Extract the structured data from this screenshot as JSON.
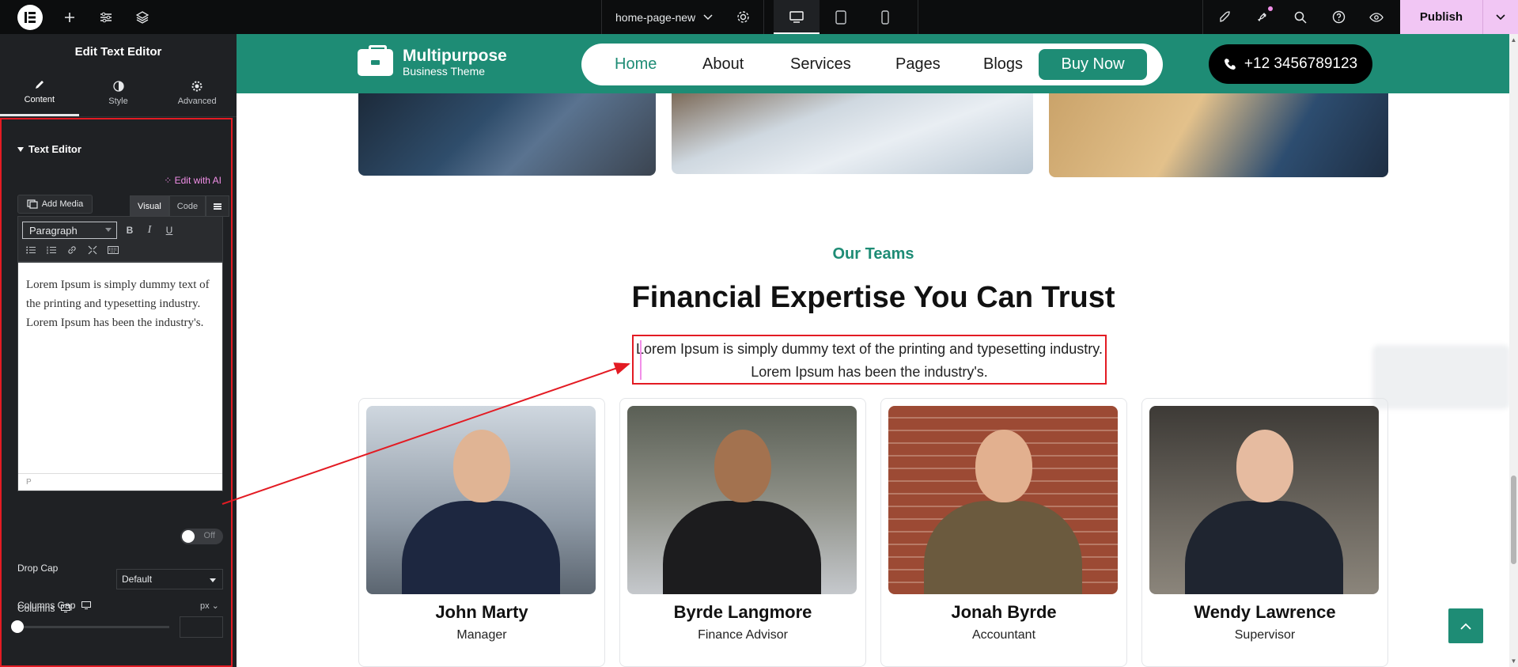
{
  "topbar": {
    "document_name": "home-page-new",
    "publish_label": "Publish"
  },
  "panel": {
    "title": "Edit Text Editor",
    "tabs": [
      {
        "label": "Content",
        "icon": "pencil-icon"
      },
      {
        "label": "Style",
        "icon": "half-circle-icon"
      },
      {
        "label": "Advanced",
        "icon": "gear-icon"
      }
    ],
    "section_title": "Text Editor",
    "edit_with_ai": "Edit with AI",
    "add_media": "Add Media",
    "mode_visual": "Visual",
    "mode_code": "Code",
    "format_select": "Paragraph",
    "editor_text": "Lorem Ipsum is simply dummy text of the printing and typesetting industry. Lorem Ipsum has been the industry's.",
    "editor_status": "P",
    "drop_cap_label": "Drop Cap",
    "drop_cap_state": "Off",
    "columns_label": "Columns",
    "columns_value": "Default",
    "columns_gap_label": "Columns Gap",
    "columns_gap_unit": "px",
    "columns_gap_value": ""
  },
  "site": {
    "brand_name": "Multipurpose",
    "brand_sub": "Business Theme",
    "nav": [
      "Home",
      "About",
      "Services",
      "Pages",
      "Blogs"
    ],
    "buy_now": "Buy Now",
    "phone": "+12 3456789123",
    "kicker": "Our Teams",
    "heading": "Financial Expertise You Can Trust",
    "intro": "Lorem Ipsum is simply dummy text of the printing and typesetting industry. Lorem Ipsum has been the industry's.",
    "team": [
      {
        "name": "John Marty",
        "role": "Manager"
      },
      {
        "name": "Byrde Langmore",
        "role": "Finance Advisor"
      },
      {
        "name": "Jonah Byrde",
        "role": "Accountant"
      },
      {
        "name": "Wendy Lawrence",
        "role": "Supervisor"
      }
    ]
  },
  "colors": {
    "brand_green": "#1e8c75",
    "highlight_red": "#e31b23",
    "publish_pink": "#f1c6f4",
    "panel_dark": "#1f2124"
  }
}
